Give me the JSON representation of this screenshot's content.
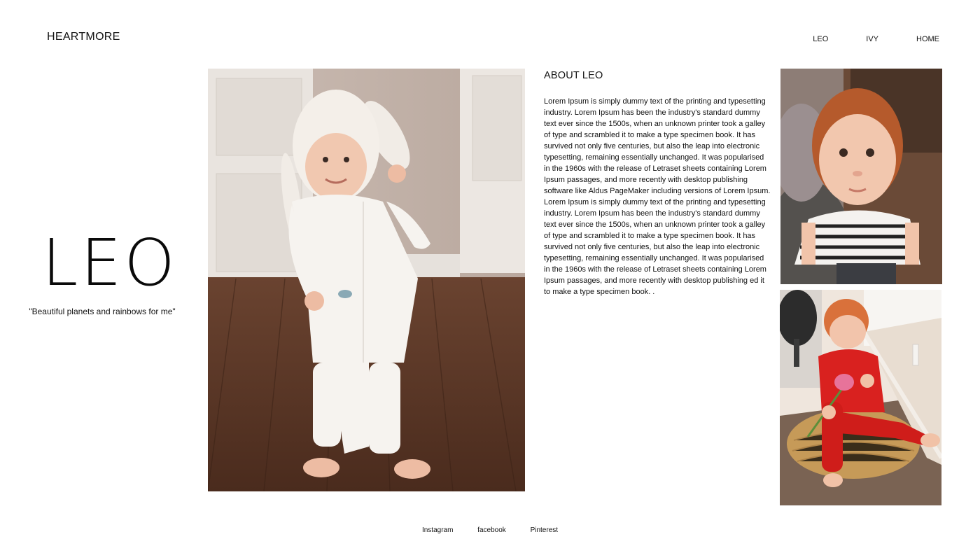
{
  "brand": "HEARTMORE",
  "nav": {
    "items": [
      "LEO",
      "IVY",
      "HOME"
    ]
  },
  "hero": {
    "title": "LEO",
    "quote": "\"Beautiful planets and rainbows for me\""
  },
  "about": {
    "title": "ABOUT LEO",
    "body": "Lorem Ipsum is simply dummy text of the printing and typesetting industry. Lorem Ipsum has been the industry's standard dummy text ever since the 1500s, when an unknown printer took a galley of type and scrambled it to make a type specimen book. It has survived not only five centuries, but also the leap into electronic typesetting, remaining essentially unchanged. It was popularised in the 1960s with the release of Letraset sheets containing Lorem Ipsum passages, and more recently with desktop publishing software like Aldus PageMaker including versions of Lorem Ipsum. Lorem Ipsum is simply dummy text of the printing and typesetting industry. Lorem Ipsum has been the industry's standard dummy text ever since the 1500s, when an unknown printer took a galley of type and scrambled it to make a type specimen book. It has survived not only five centuries, but also the leap into electronic typesetting, remaining essentially unchanged. It was popularised in the 1960s with the release of Letraset sheets containing Lorem Ipsum passages, and more recently with desktop publishing ed it to make a type specimen book. ."
  },
  "footer": {
    "links": [
      "Instagram",
      "facebook",
      "Pinterest"
    ]
  }
}
